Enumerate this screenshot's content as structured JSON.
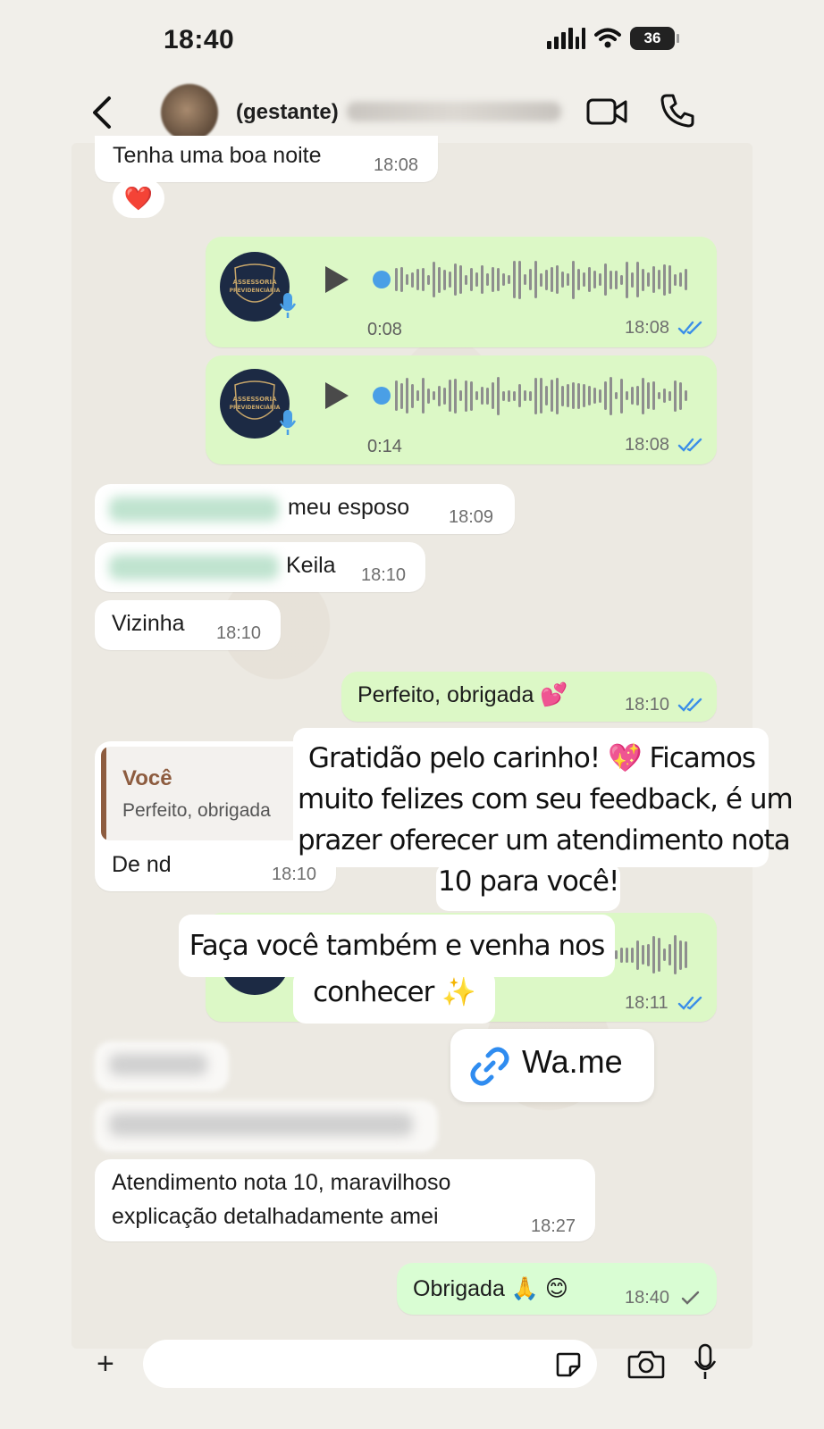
{
  "status_bar": {
    "time": "18:40",
    "battery": "36"
  },
  "header": {
    "contact_name": "(gestante)"
  },
  "messages": {
    "m1": {
      "text": "Tenha uma boa noite",
      "time": "18:08",
      "reaction": "❤️"
    },
    "audio1": {
      "duration": "0:08",
      "time": "18:08"
    },
    "audio2": {
      "duration": "0:14",
      "time": "18:08"
    },
    "m2": {
      "text": "meu esposo",
      "time": "18:09"
    },
    "m3": {
      "text": "Keila",
      "time": "18:10"
    },
    "m4": {
      "text": "Vizinha",
      "time": "18:10"
    },
    "m5": {
      "text": "Perfeito, obrigada 💕",
      "time": "18:10"
    },
    "m6": {
      "reply_author": "Você",
      "reply_text": "Perfeito, obrigada",
      "text": "De nd",
      "time": "18:10"
    },
    "audio3": {
      "time": "18:11"
    },
    "m7": {
      "text_line1": "Atendimento nota 10, maravilhoso",
      "text_line2": "explicação detalhadamente amei",
      "time": "18:27"
    },
    "m8": {
      "text": "Obrigada 🙏 😊",
      "time": "18:40"
    }
  },
  "audio_logo": {
    "line1": "ASSESSORIA",
    "line2": "PREVIDENCIÁRIA"
  },
  "overlays": {
    "caption1": {
      "line1": "Gratidão pelo carinho! 💖 Ficamos",
      "line2": "muito felizes com seu feedback, é um",
      "line3": "prazer oferecer um atendimento nota",
      "line4": "10 para você!"
    },
    "caption2": {
      "line1": "Faça você também e venha nos",
      "line2": "conhecer ✨"
    },
    "link": {
      "label": "Wa.me"
    }
  },
  "colors": {
    "outgoing_bubble": "#dcf8c6",
    "incoming_bubble": "#ffffff",
    "read_ticks": "#3b8ee8",
    "reply_accent": "#8d5c3f"
  }
}
